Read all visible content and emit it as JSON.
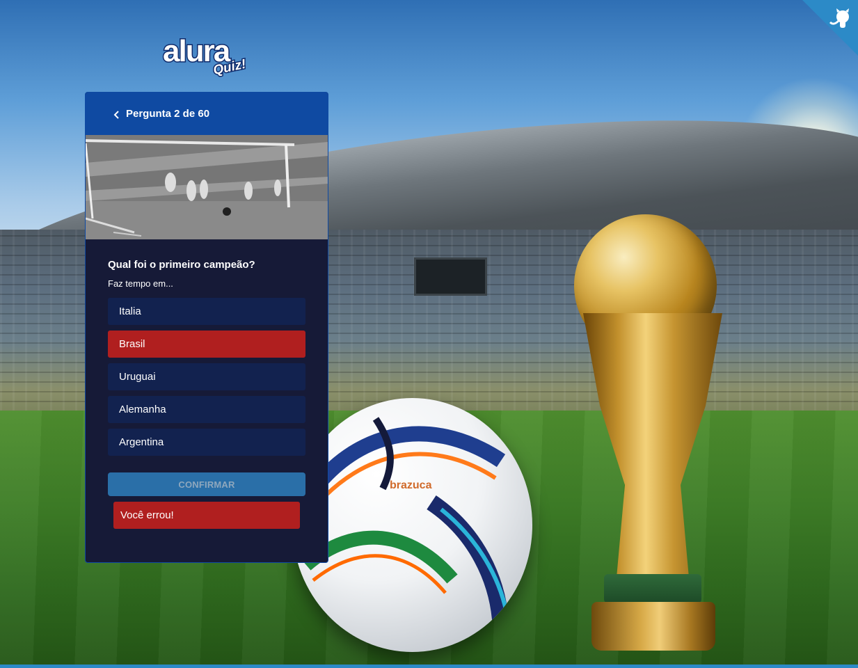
{
  "logo": {
    "word": "alura",
    "sub": "Quiz!"
  },
  "card": {
    "header_title": "Pergunta 2 de 60",
    "question": {
      "title": "Qual foi o primeiro campeão?",
      "description": "Faz tempo em..."
    },
    "answers": [
      {
        "label": "Italia",
        "selected": false
      },
      {
        "label": "Brasil",
        "selected": true
      },
      {
        "label": "Uruguai",
        "selected": false
      },
      {
        "label": "Alemanha",
        "selected": false
      },
      {
        "label": "Argentina",
        "selected": false
      }
    ],
    "confirm_label": "CONFIRMAR",
    "result": "Você errou!"
  },
  "ball_brand": "brazuca",
  "colors": {
    "primary": "#0f4aa2",
    "main_bg": "#161a37",
    "answer_bg": "#12224f",
    "wrong": "#b01f1f",
    "confirm": "#2a6fa8",
    "github_corner": "#2c8ac7"
  },
  "icons": {
    "back": "chevron-left-icon",
    "github": "octocat-icon"
  }
}
